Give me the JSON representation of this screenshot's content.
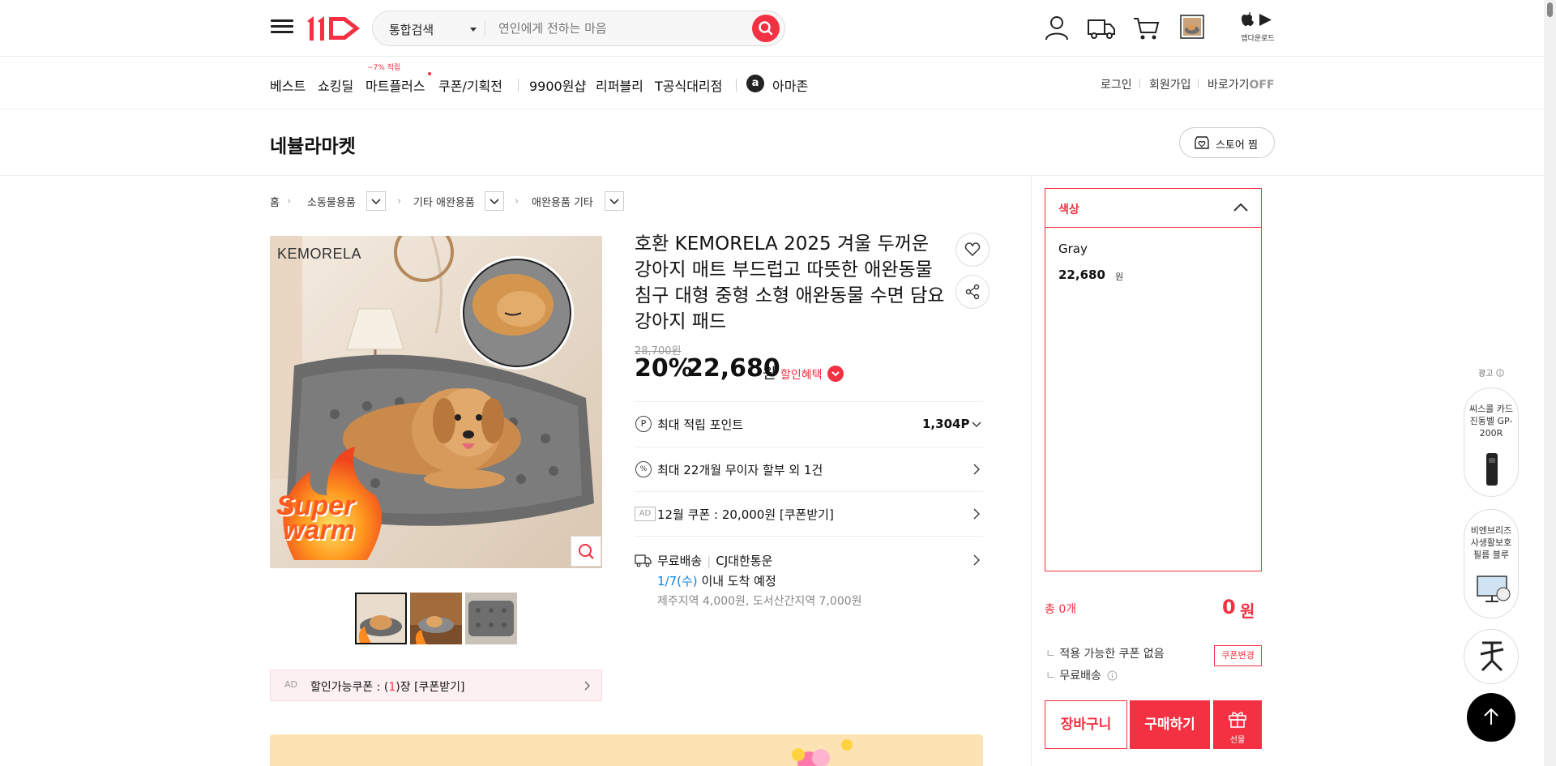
{
  "header": {
    "menu_icon": "hamburger-menu-icon",
    "logo_text": "11",
    "search": {
      "category": "통합검색",
      "placeholder": "연인에게 전하는 마음"
    },
    "icons": [
      "user-icon",
      "truck-icon",
      "cart-icon",
      "recent-item-icon"
    ],
    "app_download_label": "앱다운로드",
    "accent_color": "#f43142"
  },
  "nav": {
    "items": [
      "베스트",
      "쇼킹딜",
      "마트플러스",
      "쿠폰/기획전",
      "9900원샵",
      "리퍼블리",
      "T공식대리점",
      "아마존"
    ],
    "mart_badge": "~7% 적립",
    "amazon_icon": "a",
    "right": {
      "login": "로그인",
      "signup": "회원가입",
      "shortcut": "바로가기",
      "shortcut_state": "OFF"
    }
  },
  "store": {
    "name": "네뷸라마켓",
    "like_label": "스토어 찜"
  },
  "breadcrumb": [
    "홈",
    "소동물용품",
    "기타 애완용품",
    "애완용품 기타"
  ],
  "product": {
    "image_brand": "KEMORELA",
    "image_badge": [
      "Super",
      "warm"
    ],
    "title": "호환 KEMORELA 2025 겨울 두꺼운 강아지 매트 부드럽고 따뜻한 애완동물 침구 대형 중형 소형 애완동물 수면 담요 강아지 패드",
    "original_price": "28,700원",
    "discount_rate": "20%",
    "sale_price": "22,680",
    "won": "원",
    "benefit_label": "할인혜택",
    "thumbnails_count": 3,
    "ad_coupon": {
      "tag": "AD",
      "text_prefix": "할인가능쿠폰 : (",
      "count": "1",
      "text_suffix": ")장 [쿠폰받기]"
    },
    "info_rows": {
      "points_label": "최대 적립 포인트",
      "points_value": "1,304P",
      "installment": "최대 22개월 무이자 할부 외 1건",
      "coupon_tag": "AD",
      "coupon": "12월 쿠폰 : 20,000원 [쿠폰받기]",
      "shipping_free": "무료배송",
      "shipping_carrier": "CJ대한통운",
      "arrival_date": "1/7(수)",
      "arrival_text": "이내 도착 예정",
      "shipping_extra": "제주지역 4,000원, 도서산간지역 7,000원"
    }
  },
  "purchase": {
    "option_header": "색상",
    "option_name": "Gray",
    "option_price": "22,680",
    "option_won": "원",
    "total_label": "총 0개",
    "total_value": "0",
    "total_won": "원",
    "coupon_line": "적용 가능한 쿠폰 없음",
    "coupon_change": "쿠폰변경",
    "shipping_line": "무료배송",
    "cart_button": "장바구니",
    "buy_button": "구매하기",
    "gift_button": "선물"
  },
  "side_ads": {
    "label": "광고",
    "items": [
      "씨스콜 카드 진동벨 GP-200R",
      "비엔브리즈 사생활보호 필름 블루"
    ]
  }
}
